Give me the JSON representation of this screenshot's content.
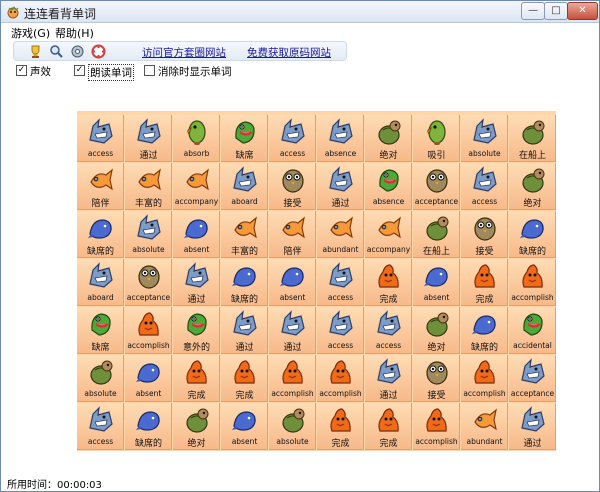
{
  "window": {
    "title": "连连看背单词"
  },
  "menu": [
    {
      "label": "游戏(G)"
    },
    {
      "label": "帮助(H)"
    }
  ],
  "toolbar": {
    "icons": [
      "trophy-icon",
      "search-icon",
      "settings-icon",
      "help-icon"
    ],
    "links": [
      {
        "label": "访问官方套圈网站"
      },
      {
        "label": "免费获取原码网站"
      }
    ]
  },
  "options": [
    {
      "label": "声效",
      "checked": true
    },
    {
      "label": "朗读单词",
      "checked": true
    },
    {
      "label": "消除时显示单词",
      "checked": false
    }
  ],
  "board": {
    "rows": [
      [
        {
          "w": "access",
          "m": "shark"
        },
        {
          "w": "通过",
          "m": "shark"
        },
        {
          "w": "absorb",
          "m": "parrot"
        },
        {
          "w": "缺席",
          "m": "lizard"
        },
        {
          "w": "access",
          "m": "shark"
        },
        {
          "w": "absence",
          "m": "shark"
        },
        {
          "w": "绝对",
          "m": "turtle"
        },
        {
          "w": "吸引",
          "m": "parrot"
        },
        {
          "w": "absolute",
          "m": "shark"
        },
        {
          "w": "在船上",
          "m": "turtle"
        }
      ],
      [
        {
          "w": "陪伴",
          "m": "fish"
        },
        {
          "w": "丰富的",
          "m": "fish"
        },
        {
          "w": "accompany",
          "m": "fish"
        },
        {
          "w": "aboard",
          "m": "shark"
        },
        {
          "w": "接受",
          "m": "owl"
        },
        {
          "w": "通过",
          "m": "shark"
        },
        {
          "w": "absence",
          "m": "lizard"
        },
        {
          "w": "acceptance",
          "m": "owl"
        },
        {
          "w": "access",
          "m": "shark"
        },
        {
          "w": "绝对",
          "m": "turtle"
        }
      ],
      [
        {
          "w": "缺席的",
          "m": "whale"
        },
        {
          "w": "absolute",
          "m": "shark"
        },
        {
          "w": "absent",
          "m": "whale"
        },
        {
          "w": "丰富的",
          "m": "fish"
        },
        {
          "w": "陪伴",
          "m": "fish"
        },
        {
          "w": "abundant",
          "m": "fish"
        },
        {
          "w": "accompany",
          "m": "fish"
        },
        {
          "w": "在船上",
          "m": "turtle"
        },
        {
          "w": "接受",
          "m": "owl"
        },
        {
          "w": "缺席的",
          "m": "whale"
        }
      ],
      [
        {
          "w": "aboard",
          "m": "shark"
        },
        {
          "w": "acceptance",
          "m": "owl"
        },
        {
          "w": "通过",
          "m": "shark"
        },
        {
          "w": "缺席的",
          "m": "whale"
        },
        {
          "w": "absent",
          "m": "whale"
        },
        {
          "w": "access",
          "m": "shark"
        },
        {
          "w": "完成",
          "m": "blob"
        },
        {
          "w": "absent",
          "m": "whale"
        },
        {
          "w": "完成",
          "m": "blob"
        },
        {
          "w": "accomplish",
          "m": "blob"
        }
      ],
      [
        {
          "w": "缺席",
          "m": "lizard"
        },
        {
          "w": "accomplish",
          "m": "blob"
        },
        {
          "w": "意外的",
          "m": "lizard"
        },
        {
          "w": "通过",
          "m": "shark"
        },
        {
          "w": "通过",
          "m": "shark"
        },
        {
          "w": "access",
          "m": "shark"
        },
        {
          "w": "access",
          "m": "shark"
        },
        {
          "w": "绝对",
          "m": "turtle"
        },
        {
          "w": "缺席的",
          "m": "whale"
        },
        {
          "w": "accidental",
          "m": "lizard"
        }
      ],
      [
        {
          "w": "absolute",
          "m": "turtle"
        },
        {
          "w": "absent",
          "m": "whale"
        },
        {
          "w": "完成",
          "m": "blob"
        },
        {
          "w": "完成",
          "m": "blob"
        },
        {
          "w": "accomplish",
          "m": "blob"
        },
        {
          "w": "accomplish",
          "m": "blob"
        },
        {
          "w": "通过",
          "m": "shark"
        },
        {
          "w": "接受",
          "m": "owl"
        },
        {
          "w": "accomplish",
          "m": "blob"
        },
        {
          "w": "acceptance",
          "m": "shark"
        }
      ],
      [
        {
          "w": "access",
          "m": "shark"
        },
        {
          "w": "缺席的",
          "m": "whale"
        },
        {
          "w": "绝对",
          "m": "turtle"
        },
        {
          "w": "absent",
          "m": "whale"
        },
        {
          "w": "absolute",
          "m": "turtle"
        },
        {
          "w": "完成",
          "m": "blob"
        },
        {
          "w": "完成",
          "m": "blob"
        },
        {
          "w": "accomplish",
          "m": "blob"
        },
        {
          "w": "abundant",
          "m": "fish"
        },
        {
          "w": "通过",
          "m": "shark"
        }
      ]
    ]
  },
  "status": {
    "elapsed": "所用时间：00:00:03"
  },
  "colors": {
    "tile_bg": "#f7b98a",
    "board_bg": "#ffd6a8",
    "link": "#1a1a9a",
    "titlebar": "#dbe5f2"
  }
}
